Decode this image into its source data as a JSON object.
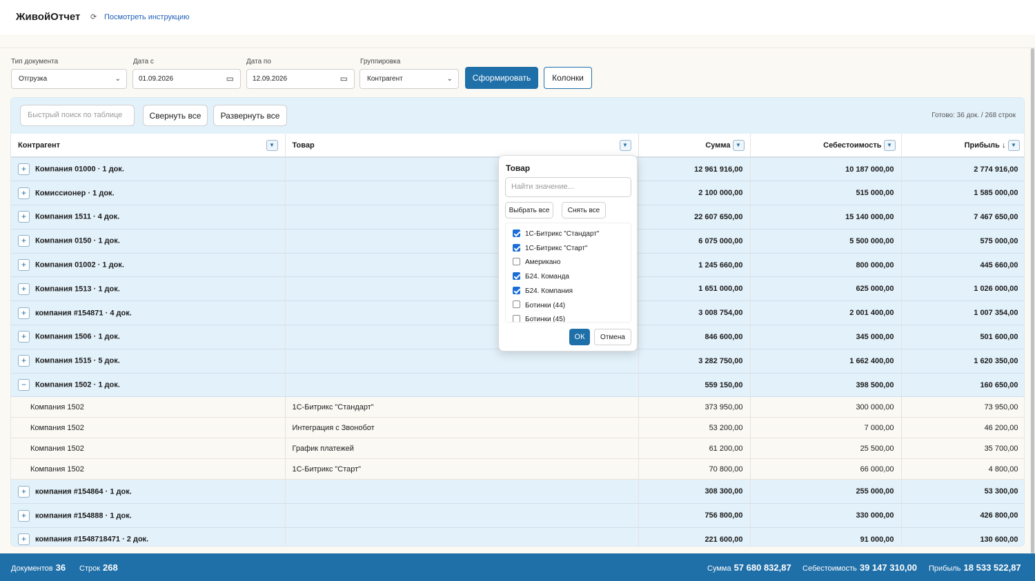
{
  "header": {
    "title": "ЖивойОтчет",
    "refresh_icon": "⟳",
    "help_link": "Посмотреть инструкцию"
  },
  "filters": {
    "doc_type": {
      "label": "Тип документа",
      "value": "Отгрузка"
    },
    "date_from": {
      "label": "Дата с",
      "value": "01.09.2026"
    },
    "date_to": {
      "label": "Дата по",
      "value": "12.09.2026"
    },
    "grouping": {
      "label": "Группировка",
      "value": "Контрагент"
    },
    "generate_label": "Сформировать",
    "columns_label": "Колонки"
  },
  "toolbar": {
    "search_placeholder": "Быстрый поиск по таблице",
    "collapse_all": "Свернуть все",
    "expand_all": "Развернуть все",
    "status": "Готово: 36 док. / 268 строк"
  },
  "columns": {
    "counterparty": "Контрагент",
    "product": "Товар",
    "sum": "Сумма",
    "cost": "Себестоимость",
    "profit": "Прибыль ↓"
  },
  "rows": [
    {
      "type": "group",
      "toggle": "+",
      "name": "Компания 01000 · 1 док.",
      "product": "",
      "sum": "12 961 916,00",
      "cost": "10 187 000,00",
      "profit": "2 774 916,00"
    },
    {
      "type": "group",
      "toggle": "+",
      "name": "Комиссионер · 1 док.",
      "product": "",
      "sum": "2 100 000,00",
      "cost": "515 000,00",
      "profit": "1 585 000,00"
    },
    {
      "type": "group",
      "toggle": "+",
      "name": "Компания 1511 · 4 док.",
      "product": "",
      "sum": "22 607 650,00",
      "cost": "15 140 000,00",
      "profit": "7 467 650,00"
    },
    {
      "type": "group",
      "toggle": "+",
      "name": "Компания 0150 · 1 док.",
      "product": "",
      "sum": "6 075 000,00",
      "cost": "5 500 000,00",
      "profit": "575 000,00"
    },
    {
      "type": "group",
      "toggle": "+",
      "name": "Компания 01002 · 1 док.",
      "product": "",
      "sum": "1 245 660,00",
      "cost": "800 000,00",
      "profit": "445 660,00"
    },
    {
      "type": "group",
      "toggle": "+",
      "name": "Компания 1513 · 1 док.",
      "product": "",
      "sum": "1 651 000,00",
      "cost": "625 000,00",
      "profit": "1 026 000,00"
    },
    {
      "type": "group",
      "toggle": "+",
      "name": "компания #154871 · 4 док.",
      "product": "",
      "sum": "3 008 754,00",
      "cost": "2 001 400,00",
      "profit": "1 007 354,00"
    },
    {
      "type": "group",
      "toggle": "+",
      "name": "Компания 1506 · 1 док.",
      "product": "",
      "sum": "846 600,00",
      "cost": "345 000,00",
      "profit": "501 600,00"
    },
    {
      "type": "group",
      "toggle": "+",
      "name": "Компания 1515 · 5 док.",
      "product": "",
      "sum": "3 282 750,00",
      "cost": "1 662 400,00",
      "profit": "1 620 350,00"
    },
    {
      "type": "group",
      "toggle": "−",
      "name": "Компания 1502 · 1 док.",
      "product": "",
      "sum": "559 150,00",
      "cost": "398 500,00",
      "profit": "160 650,00"
    },
    {
      "type": "detail",
      "name": "Компания 1502",
      "product": "1С-Битрикс \"Стандарт\"",
      "sum": "373 950,00",
      "cost": "300 000,00",
      "profit": "73 950,00"
    },
    {
      "type": "detail",
      "name": "Компания 1502",
      "product": "Интеграция с Звонобот",
      "sum": "53 200,00",
      "cost": "7 000,00",
      "profit": "46 200,00"
    },
    {
      "type": "detail",
      "name": "Компания 1502",
      "product": "График платежей",
      "sum": "61 200,00",
      "cost": "25 500,00",
      "profit": "35 700,00"
    },
    {
      "type": "detail",
      "name": "Компания 1502",
      "product": "1С-Битрикс \"Старт\"",
      "sum": "70 800,00",
      "cost": "66 000,00",
      "profit": "4 800,00"
    },
    {
      "type": "group",
      "toggle": "+",
      "name": "компания #154864 · 1 док.",
      "product": "",
      "sum": "308 300,00",
      "cost": "255 000,00",
      "profit": "53 300,00"
    },
    {
      "type": "group",
      "toggle": "+",
      "name": "компания #154888 · 1 док.",
      "product": "",
      "sum": "756 800,00",
      "cost": "330 000,00",
      "profit": "426 800,00"
    },
    {
      "type": "group",
      "toggle": "+",
      "name": "компания #1548718471 · 2 док.",
      "product": "",
      "sum": "221 600,00",
      "cost": "91 000,00",
      "profit": "130 600,00"
    }
  ],
  "popup": {
    "title": "Товар",
    "search_placeholder": "Найти значение...",
    "select_all": "Выбрать все",
    "clear_all": "Снять все",
    "items": [
      {
        "label": "1С-Битрикс \"Стандарт\"",
        "checked": true
      },
      {
        "label": "1С-Битрикс \"Старт\"",
        "checked": true
      },
      {
        "label": "Американо",
        "checked": false
      },
      {
        "label": "Б24. Команда",
        "checked": true
      },
      {
        "label": "Б24. Компания",
        "checked": true
      },
      {
        "label": "Ботинки (44)",
        "checked": false
      },
      {
        "label": "Ботинки (45)",
        "checked": false
      }
    ],
    "ok": "ОК",
    "cancel": "Отмена"
  },
  "footer": {
    "docs_label": "Документов",
    "docs_value": "36",
    "rows_label": "Строк",
    "rows_value": "268",
    "sum_label": "Сумма",
    "sum_value": "57 680 832,87",
    "cost_label": "Себестоимость",
    "cost_value": "39 147 310,00",
    "profit_label": "Прибыль",
    "profit_value": "18 533 522,87"
  },
  "icons": {
    "chevron": "⌄",
    "calendar": "▭",
    "filter": "▼"
  }
}
